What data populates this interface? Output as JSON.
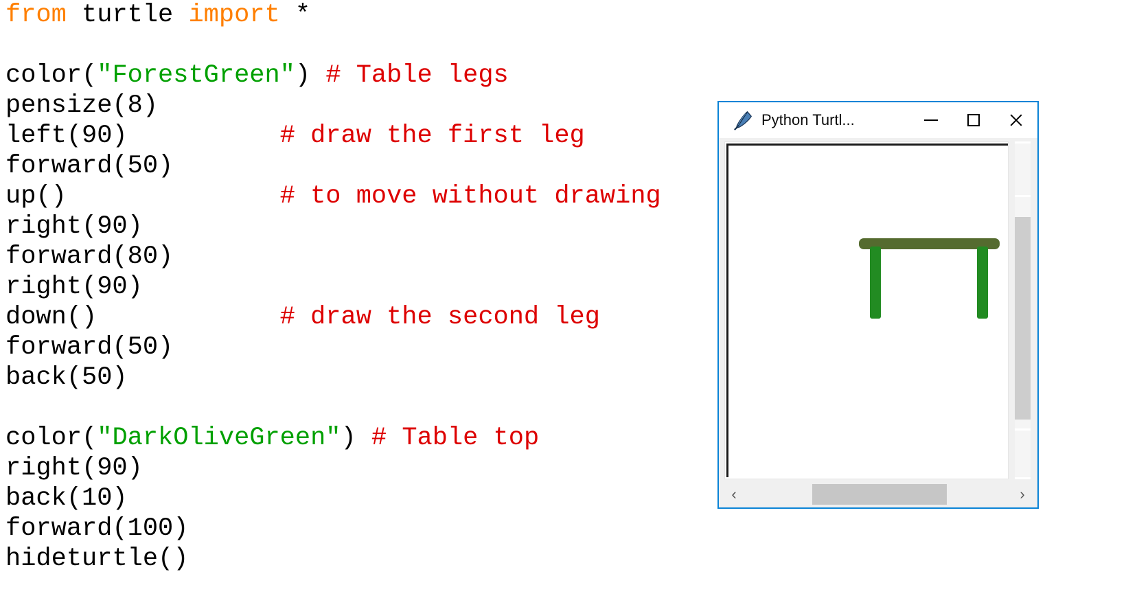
{
  "code": {
    "language": "python",
    "lines": [
      [
        {
          "t": "from",
          "c": "kw"
        },
        {
          "t": " turtle ",
          "c": "plain"
        },
        {
          "t": "import",
          "c": "kw"
        },
        {
          "t": " *",
          "c": "plain"
        }
      ],
      [
        {
          "t": "",
          "c": "plain"
        }
      ],
      [
        {
          "t": "color(",
          "c": "plain"
        },
        {
          "t": "\"ForestGreen\"",
          "c": "str"
        },
        {
          "t": ") ",
          "c": "plain"
        },
        {
          "t": "# Table legs",
          "c": "cmt"
        }
      ],
      [
        {
          "t": "pensize(8)",
          "c": "plain"
        }
      ],
      [
        {
          "t": "left(90)          ",
          "c": "plain"
        },
        {
          "t": "# draw the first leg",
          "c": "cmt"
        }
      ],
      [
        {
          "t": "forward(50)",
          "c": "plain"
        }
      ],
      [
        {
          "t": "up()              ",
          "c": "plain"
        },
        {
          "t": "# to move without drawing",
          "c": "cmt"
        }
      ],
      [
        {
          "t": "right(90)",
          "c": "plain"
        }
      ],
      [
        {
          "t": "forward(80)",
          "c": "plain"
        }
      ],
      [
        {
          "t": "right(90)",
          "c": "plain"
        }
      ],
      [
        {
          "t": "down()            ",
          "c": "plain"
        },
        {
          "t": "# draw the second leg",
          "c": "cmt"
        }
      ],
      [
        {
          "t": "forward(50)",
          "c": "plain"
        }
      ],
      [
        {
          "t": "back(50)",
          "c": "plain"
        }
      ],
      [
        {
          "t": "",
          "c": "plain"
        }
      ],
      [
        {
          "t": "color(",
          "c": "plain"
        },
        {
          "t": "\"DarkOliveGreen\"",
          "c": "str"
        },
        {
          "t": ") ",
          "c": "plain"
        },
        {
          "t": "# Table top",
          "c": "cmt"
        }
      ],
      [
        {
          "t": "right(90)",
          "c": "plain"
        }
      ],
      [
        {
          "t": "back(10)",
          "c": "plain"
        }
      ],
      [
        {
          "t": "forward(100)",
          "c": "plain"
        }
      ],
      [
        {
          "t": "hideturtle()",
          "c": "plain"
        }
      ]
    ],
    "colors": {
      "keyword": "#ff7f00",
      "string": "#00a000",
      "comment": "#dd0000",
      "text": "#000000",
      "background": "#ffffff"
    }
  },
  "turtle_window": {
    "title": "Python Turtl...",
    "icon": "python-feather-icon",
    "accent_border": "#0a83d6",
    "buttons": {
      "minimize": "minimize-button",
      "maximize": "maximize-button",
      "close": "close-button"
    },
    "canvas": {
      "background": "#ffffff",
      "drawing": {
        "name": "turtle-table-drawing",
        "table_top_color": "#556B2F",
        "table_legs_color": "#228B22",
        "pensize": 8
      }
    },
    "scrollbars": {
      "vertical": {
        "thumb_color": "#cdcdcd",
        "track_color": "#f5f5f5"
      },
      "horizontal": {
        "left_arrow": "‹",
        "right_arrow": "›",
        "thumb_color": "#c6c6c6",
        "track_color": "#f0f0f0"
      }
    }
  }
}
